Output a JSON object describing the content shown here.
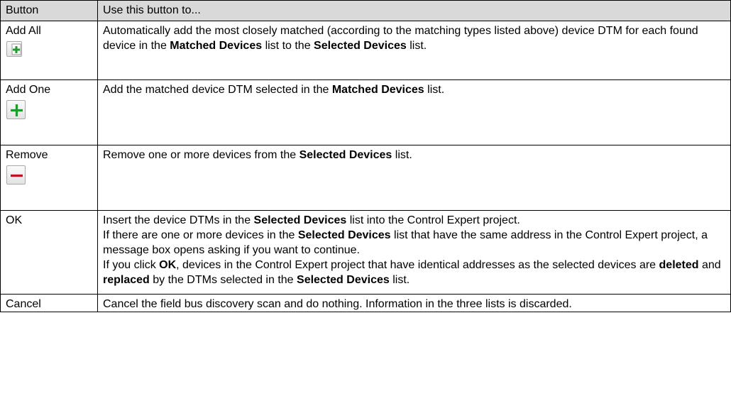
{
  "header": {
    "button": "Button",
    "use": "Use this button to..."
  },
  "colors": {
    "header_bg": "#d9d9d9",
    "plus_green": "#1e9a2e",
    "minus_red": "#c0102a"
  },
  "rows": [
    {
      "name": "Add All",
      "icon": "add-all-icon",
      "desc": [
        [
          "Automatically add the most closely matched (according to the matching types listed above)",
          false
        ],
        [
          " device DTM for each found device in the ",
          false
        ],
        [
          "Matched Devices",
          true
        ],
        [
          " list to the ",
          false
        ],
        [
          "Selected Devices",
          true
        ],
        [
          " list.",
          false
        ]
      ]
    },
    {
      "name": "Add One",
      "icon": "add-one-icon",
      "desc": [
        [
          "Add the matched device DTM selected in the ",
          false
        ],
        [
          "Matched Devices",
          true
        ],
        [
          " list.",
          false
        ]
      ]
    },
    {
      "name": "Remove",
      "icon": "remove-icon",
      "desc": [
        [
          "Remove one or more devices from the ",
          false
        ],
        [
          "Selected Devices",
          true
        ],
        [
          " list.",
          false
        ]
      ]
    },
    {
      "name": "OK",
      "icon": "",
      "desc": [
        [
          "Insert the device DTMs in the ",
          false
        ],
        [
          "Selected Devices",
          true
        ],
        [
          " list into the Control Expert project.",
          false
        ],
        [
          "\n",
          false
        ],
        [
          "If there are one or more devices in the ",
          false
        ],
        [
          "Selected Devices",
          true
        ],
        [
          " list that have the same address in the Control Expert project, a message box opens asking if you want to continue.",
          false
        ],
        [
          "\n",
          false
        ],
        [
          "If you click ",
          false
        ],
        [
          "OK",
          true
        ],
        [
          ", devices in the Control Expert project that have identical addresses as the selected devices are ",
          false
        ],
        [
          "deleted",
          true
        ],
        [
          " and ",
          false
        ],
        [
          "replaced",
          true
        ],
        [
          " by the DTMs selected in the ",
          false
        ],
        [
          "Selected Devices",
          true
        ],
        [
          " list.",
          false
        ]
      ]
    },
    {
      "name": "Cancel",
      "icon": "",
      "desc": [
        [
          "Cancel the field bus discovery scan and do nothing. Information in the three lists is discarded.",
          false
        ]
      ]
    }
  ]
}
